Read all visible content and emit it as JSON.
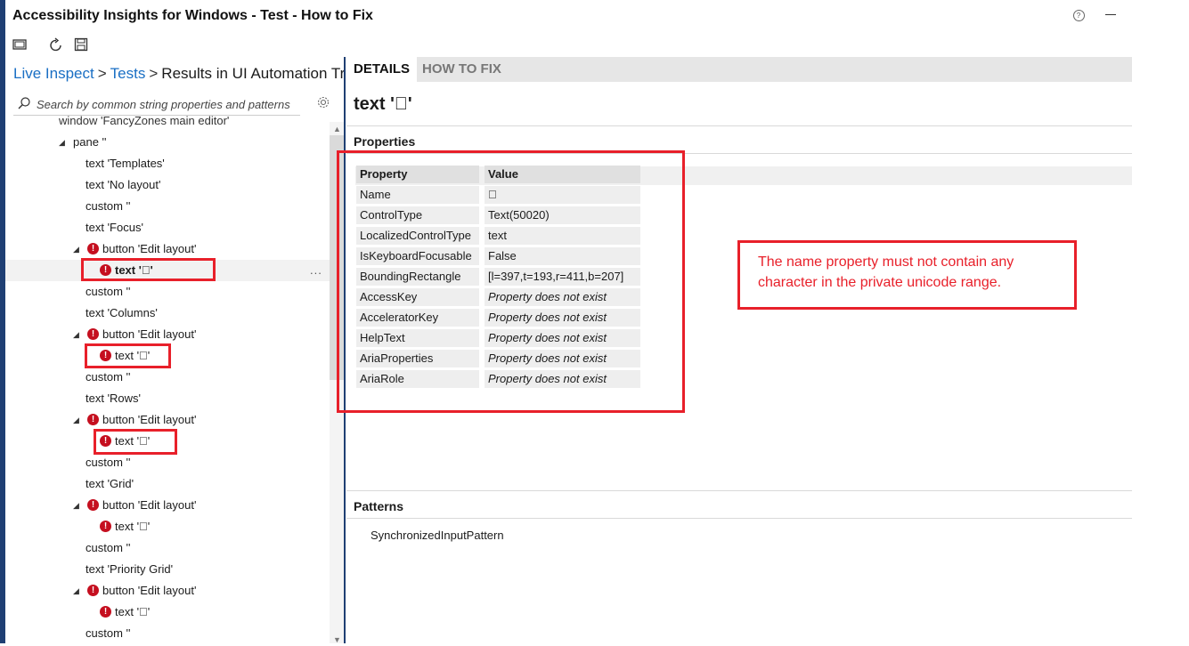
{
  "window": {
    "title": "Accessibility Insights for Windows - Test - How to Fix",
    "help_icon": "question-circle-icon",
    "minimize_icon": "minimize-icon"
  },
  "toolbar": {
    "icons": [
      "screen-icon",
      "refresh-icon",
      "save-icon"
    ]
  },
  "breadcrumb": {
    "live_inspect": "Live Inspect",
    "tests": "Tests",
    "current": "Results in UI Automation Tree"
  },
  "search": {
    "placeholder": "Search by common string properties and patterns"
  },
  "tree": {
    "partial_top": "window 'FancyZones main editor'",
    "rows": [
      {
        "label": "pane ''"
      },
      {
        "label": "text 'Templates'"
      },
      {
        "label": "text 'No layout'"
      },
      {
        "label": "custom ''"
      },
      {
        "label": "text 'Focus'"
      },
      {
        "label": "button 'Edit layout'"
      },
      {
        "label": "text ''"
      },
      {
        "label": "custom ''"
      },
      {
        "label": "text 'Columns'"
      },
      {
        "label": "button 'Edit layout'"
      },
      {
        "label": "text ''"
      },
      {
        "label": "custom ''"
      },
      {
        "label": "text 'Rows'"
      },
      {
        "label": "button 'Edit layout'"
      },
      {
        "label": "text ''"
      },
      {
        "label": "custom ''"
      },
      {
        "label": "text 'Grid'"
      },
      {
        "label": "button 'Edit layout'"
      },
      {
        "label": "text ''"
      },
      {
        "label": "custom ''"
      },
      {
        "label": "text 'Priority Grid'"
      },
      {
        "label": "button 'Edit layout'"
      },
      {
        "label": "text ''"
      },
      {
        "label": "custom ''"
      }
    ],
    "more_label": "..."
  },
  "tabs": {
    "details": "DETAILS",
    "how_to_fix": "HOW TO FIX"
  },
  "element_title": "text ''",
  "properties": {
    "header": "Properties",
    "col_property": "Property",
    "col_value": "Value",
    "rows": [
      {
        "name": "Name",
        "value": ""
      },
      {
        "name": "ControlType",
        "value": "Text(50020)"
      },
      {
        "name": "LocalizedControlType",
        "value": "text"
      },
      {
        "name": "IsKeyboardFocusable",
        "value": "False"
      },
      {
        "name": "BoundingRectangle",
        "value": "[l=397,t=193,r=411,b=207]"
      },
      {
        "name": "AccessKey",
        "value": "Property does not exist"
      },
      {
        "name": "AcceleratorKey",
        "value": "Property does not exist"
      },
      {
        "name": "HelpText",
        "value": "Property does not exist"
      },
      {
        "name": "AriaProperties",
        "value": "Property does not exist"
      },
      {
        "name": "AriaRole",
        "value": "Property does not exist"
      }
    ]
  },
  "annotation": "The name property must not contain any character in the private unicode range.",
  "patterns": {
    "header": "Patterns",
    "items": [
      "SynchronizedInputPattern"
    ]
  },
  "colors": {
    "accent": "#1a6fc4",
    "error": "#c50f1f",
    "annotation_red": "#e8202a",
    "side_bar": "#1f3f73"
  }
}
